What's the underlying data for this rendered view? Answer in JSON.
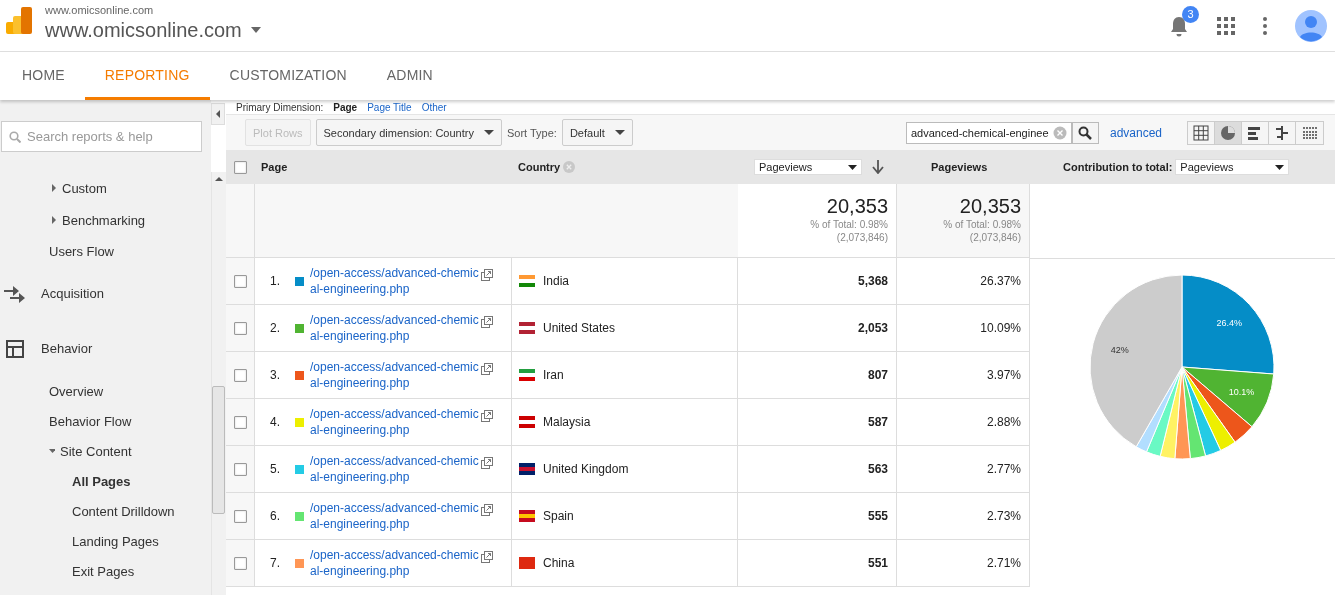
{
  "header": {
    "account": "www.omicsonline.com",
    "property": "www.omicsonline.com",
    "notification_count": "3"
  },
  "nav_tabs": [
    {
      "label": "HOME",
      "selected": false
    },
    {
      "label": "REPORTING",
      "selected": true
    },
    {
      "label": "CUSTOMIZATION",
      "selected": false
    },
    {
      "label": "ADMIN",
      "selected": false
    }
  ],
  "sidebar": {
    "search": {
      "placeholder": "Search reports & help"
    },
    "items": [
      {
        "label": "Custom",
        "kind": "group",
        "expanded": false
      },
      {
        "label": "Benchmarking",
        "kind": "group",
        "expanded": false
      },
      {
        "label": "Users Flow",
        "kind": "link",
        "selected": false
      },
      {
        "label": "Acquisition",
        "kind": "section"
      },
      {
        "label": "Behavior",
        "kind": "section",
        "children": [
          {
            "label": "Overview",
            "kind": "link",
            "selected": false
          },
          {
            "label": "Behavior Flow",
            "kind": "link",
            "selected": false
          },
          {
            "label": "Site Content",
            "kind": "group",
            "expanded": true,
            "children": [
              {
                "label": "All Pages",
                "kind": "link",
                "selected": true
              },
              {
                "label": "Content Drilldown",
                "kind": "link",
                "selected": false
              },
              {
                "label": "Landing Pages",
                "kind": "link",
                "selected": false
              },
              {
                "label": "Exit Pages",
                "kind": "link",
                "selected": false
              }
            ]
          }
        ]
      }
    ]
  },
  "primary_dimension": {
    "label": "Primary Dimension:",
    "options": [
      {
        "label": "Page",
        "selected": true
      },
      {
        "label": "Page Title",
        "selected": false
      },
      {
        "label": "Other",
        "selected": false
      }
    ]
  },
  "toolbar": {
    "plot_rows": {
      "label": "Plot Rows",
      "disabled": true
    },
    "secondary_dimension": "Secondary dimension: Country",
    "sort_label": "Sort Type:",
    "sort_value": "Default",
    "filter_value": "advanced-chemical-enginee",
    "advanced": "advanced",
    "views": [
      {
        "kind": "table",
        "selected": false
      },
      {
        "kind": "pie",
        "selected": true
      },
      {
        "kind": "bars",
        "selected": false
      },
      {
        "kind": "compare",
        "selected": false
      },
      {
        "kind": "pivot",
        "selected": false
      }
    ]
  },
  "table": {
    "columns": {
      "page": "Page",
      "country": "Country",
      "metric_select": "Pageviews",
      "metric": "Pageviews",
      "contribution_label": "Contribution to total:",
      "contribution_select": "Pageviews"
    },
    "header_checked": false,
    "totals": [
      {
        "value": "20,353",
        "share": "% of Total: 0.98%",
        "total": "(2,073,846)"
      },
      {
        "value": "20,353",
        "share": "% of Total: 0.98%",
        "total": "(2,073,846)"
      }
    ],
    "rows": [
      {
        "index": "1.",
        "color": "#058dc7",
        "page_line_1": "/open-access/advanced-chemic",
        "page_line_2": "al-engineering.php",
        "country": "India",
        "pageviews": "5,368",
        "percent": "26.37%",
        "checked": false
      },
      {
        "index": "2.",
        "color": "#50b432",
        "page_line_1": "/open-access/advanced-chemic",
        "page_line_2": "al-engineering.php",
        "country": "United States",
        "pageviews": "2,053",
        "percent": "10.09%",
        "checked": false
      },
      {
        "index": "3.",
        "color": "#ed561b",
        "page_line_1": "/open-access/advanced-chemic",
        "page_line_2": "al-engineering.php",
        "country": "Iran",
        "pageviews": "807",
        "percent": "3.97%",
        "checked": false
      },
      {
        "index": "4.",
        "color": "#edef00",
        "page_line_1": "/open-access/advanced-chemic",
        "page_line_2": "al-engineering.php",
        "country": "Malaysia",
        "pageviews": "587",
        "percent": "2.88%",
        "checked": false
      },
      {
        "index": "5.",
        "color": "#24cbe5",
        "page_line_1": "/open-access/advanced-chemic",
        "page_line_2": "al-engineering.php",
        "country": "United Kingdom",
        "pageviews": "563",
        "percent": "2.77%",
        "checked": false
      },
      {
        "index": "6.",
        "color": "#64e572",
        "page_line_1": "/open-access/advanced-chemic",
        "page_line_2": "al-engineering.php",
        "country": "Spain",
        "pageviews": "555",
        "percent": "2.73%",
        "checked": false
      },
      {
        "index": "7.",
        "color": "#ff9655",
        "page_line_1": "/open-access/advanced-chemic",
        "page_line_2": "al-engineering.php",
        "country": "China",
        "pageviews": "551",
        "percent": "2.71%",
        "checked": false
      }
    ],
    "chart_data": {
      "type": "pie",
      "values": [
        26.4,
        10.1,
        4.0,
        2.9,
        2.8,
        2.7,
        2.7,
        2.6,
        2.5,
        2.0,
        42
      ],
      "value_labels": [
        "26.4%",
        "10.1%",
        null,
        null,
        null,
        null,
        null,
        null,
        null,
        null,
        "42%"
      ]
    }
  }
}
